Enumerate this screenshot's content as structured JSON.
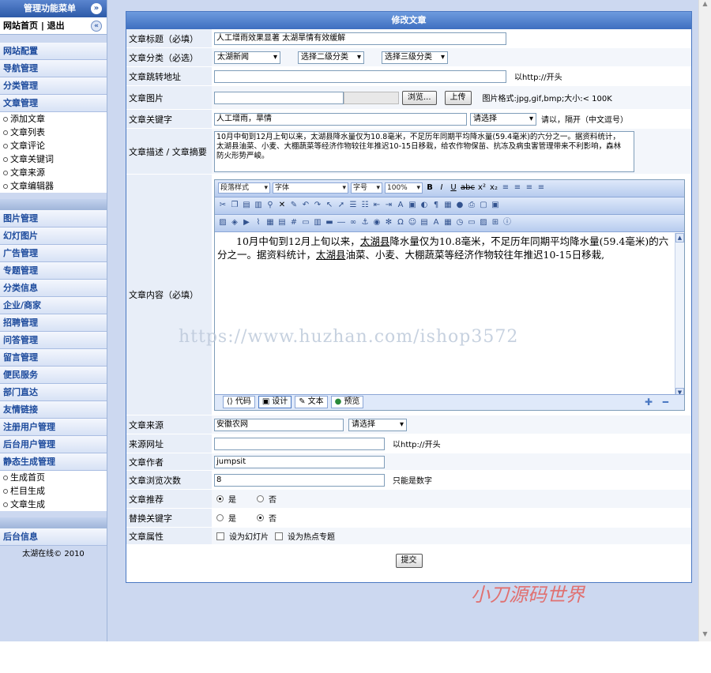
{
  "sidebar": {
    "title": "管理功能菜单",
    "top_links": "网站首页 | 退出",
    "groups1": [
      "网站配置",
      "导航管理",
      "分类管理",
      "文章管理"
    ],
    "article_subs": [
      "添加文章",
      "文章列表",
      "文章评论",
      "文章关键词",
      "文章来源",
      "文章编辑器"
    ],
    "groups2": [
      "图片管理",
      "幻灯图片",
      "广告管理",
      "专题管理",
      "分类信息",
      "企业/商家",
      "招聘管理",
      "问答管理",
      "留言管理",
      "便民服务",
      "部门直达",
      "友情链接",
      "注册用户管理",
      "后台用户管理",
      "静态生成管理"
    ],
    "static_subs": [
      "生成首页",
      "栏目生成",
      "文章生成"
    ],
    "info_title": "后台信息",
    "copyright": "太湖在线© 2010"
  },
  "form": {
    "title": "修改文章",
    "labels": {
      "title": "文章标题（必填）",
      "category": "文章分类（必选）",
      "redirect": "文章跳转地址",
      "image": "文章图片",
      "keywords": "文章关键字",
      "desc": "文章描述 / 文章摘要",
      "content": "文章内容（必填）",
      "source": "文章来源",
      "source_url": "来源网址",
      "author": "文章作者",
      "views": "文章浏览次数",
      "recommend": "文章推荐",
      "replace_kw": "替换关键字",
      "attr": "文章属性"
    },
    "values": {
      "title": "人工增雨效果显著 太湖旱情有效缓解",
      "cat1": "太湖新闻",
      "cat2": "选择二级分类",
      "cat3": "选择三级分类",
      "redirect_tip": "以http://开头",
      "browse": "浏览...",
      "upload": "上传",
      "image_tip": "图片格式:jpg,gif,bmp;大小:< 100K",
      "keywords": "人工增雨，旱情",
      "kw_select": "请选择",
      "kw_tip": "请以，隔开（中文逗号）",
      "desc": "10月中旬到12月上旬以来，太湖县降水量仅为10.8毫米，不足历年同期平均降水量(59.4毫米)的六分之一。据资料统计，太湖县油菜、小麦、大棚蔬菜等经济作物较往年推迟10-15日移栽，给农作物保苗、抗冻及病虫害管理带来不利影响，森林防火形势严峻。",
      "source": "安徽农网",
      "source_select": "请选择",
      "source_url_tip": "以http://开头",
      "author": "jumpsit",
      "views": "8",
      "views_tip": "只能是数字",
      "yes": "是",
      "no": "否",
      "attr_slide": "设为幻灯片",
      "attr_hot": "设为热点专题",
      "submit": "提交"
    }
  },
  "editor": {
    "dd_para": "段落样式",
    "dd_font": "字体",
    "dd_size": "字号",
    "dd_zoom": "100%",
    "content_p1_a": "10月中旬到12月上旬以来，",
    "content_p1_link": "太湖县",
    "content_p1_b": "降水量仅为10.8毫米，不足历年同期平均降水量(59.4毫米)的六分之一。据资料统计，",
    "content_p1_link2": "太湖县",
    "content_p1_c": "油菜、小麦、大棚蔬菜等经济作物较往年推迟10-15日移栽,",
    "tabs": [
      "代码",
      "设计",
      "文本",
      "预览"
    ]
  },
  "watermark": "https://www.huzhan.com/ishop3572",
  "watermark2": "小刀源码世界"
}
